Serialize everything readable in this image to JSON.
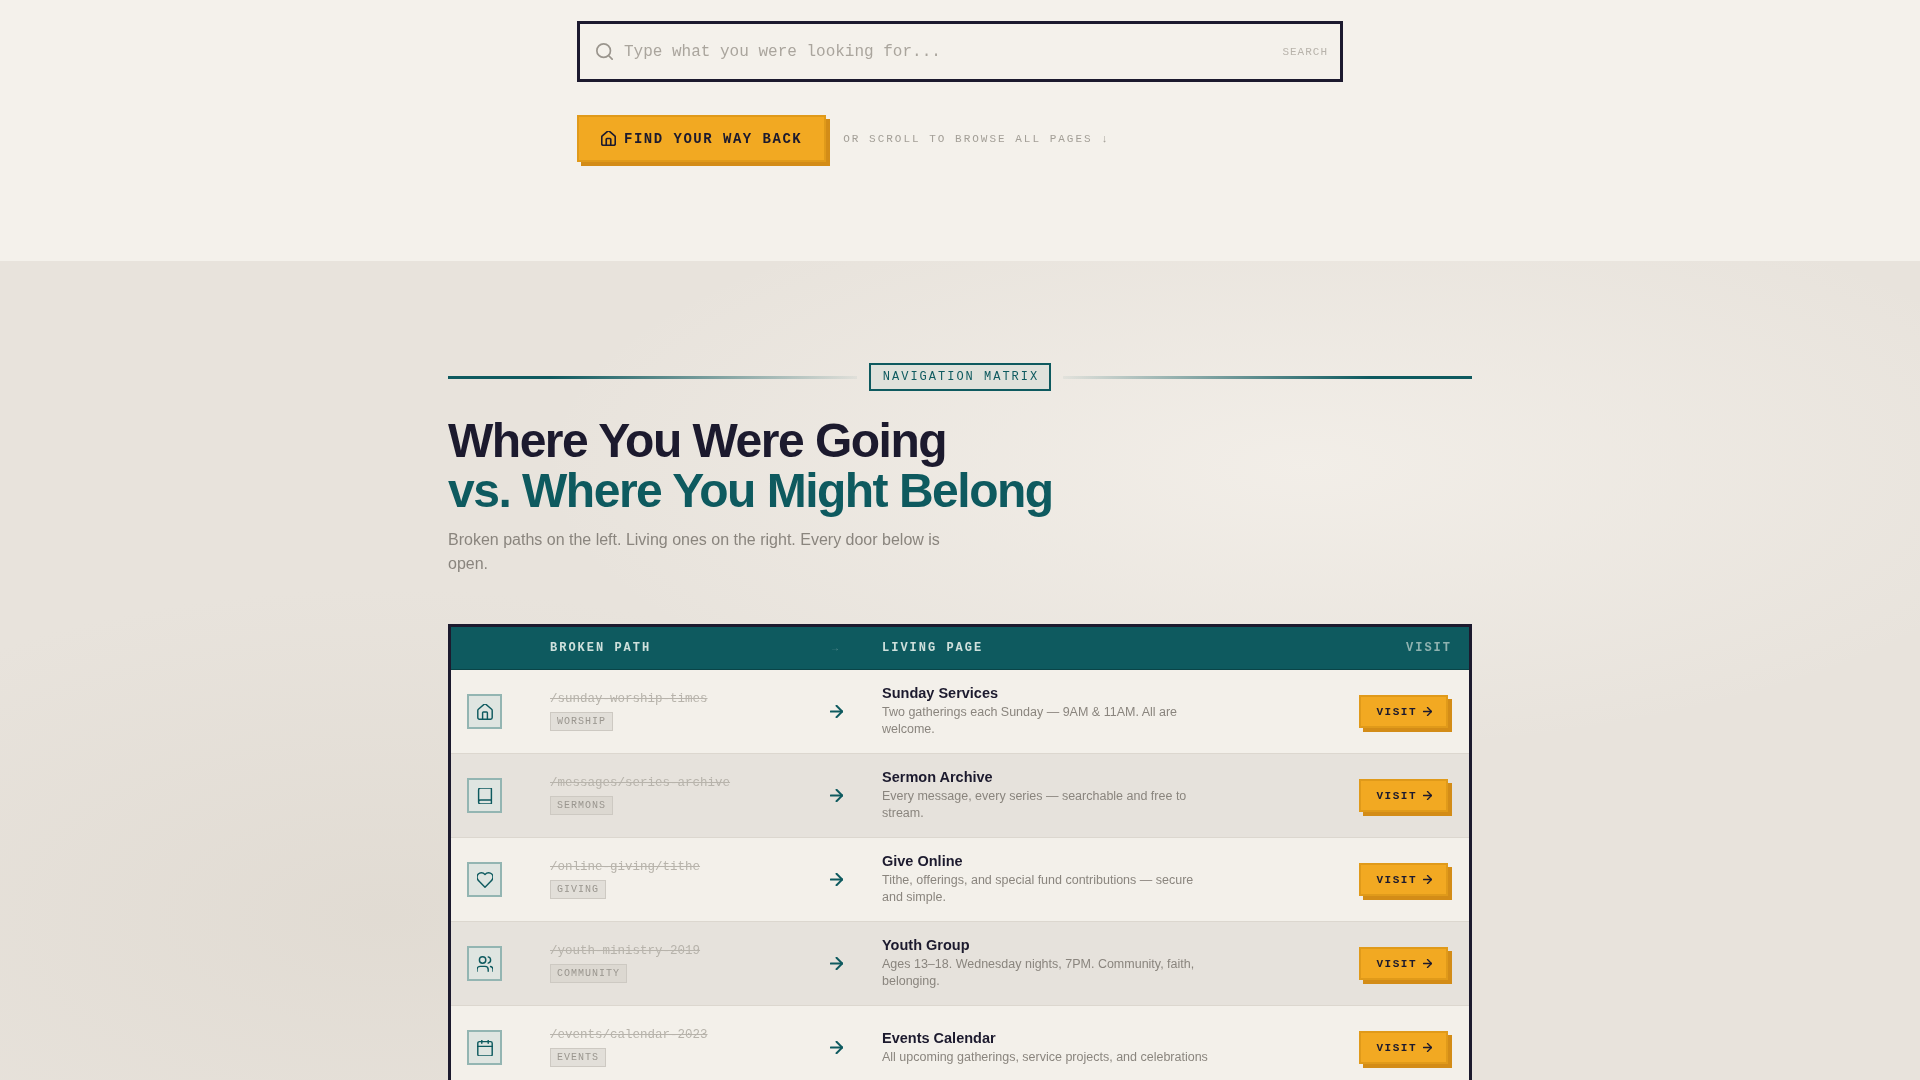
{
  "search": {
    "placeholder": "Type what you were looking for...",
    "button": "SEARCH"
  },
  "home_button": {
    "label": "FIND YOUR WAY BACK"
  },
  "scroll_hint": "OR SCROLL TO BROWSE ALL PAGES ↓",
  "section": {
    "label": "NAVIGATION MATRIX",
    "title": "Where You Were Going",
    "title_accent": "vs. Where You Might Belong",
    "intro": "Broken paths on the left. Living ones on the right. Every door below is open."
  },
  "table": {
    "columns": [
      "BROKEN PATH",
      "→",
      "LIVING PAGE",
      "VISIT"
    ],
    "rows": [
      {
        "broken_path": "/sunday-worship-times",
        "tag": "WORSHIP",
        "page": "Sunday Services",
        "description": "Two gatherings each Sunday — 9AM & 11AM. All are welcome.",
        "action": "VISIT"
      },
      {
        "broken_path": "/messages/series-archive",
        "tag": "SERMONS",
        "page": "Sermon Archive",
        "description": "Every message, every series — searchable and free to stream.",
        "action": "VISIT"
      },
      {
        "broken_path": "/online-giving/tithe",
        "tag": "GIVING",
        "page": "Give Online",
        "description": "Tithe, offerings, and special fund contributions — secure and simple.",
        "action": "VISIT"
      },
      {
        "broken_path": "/youth-ministry-2019",
        "tag": "COMMUNITY",
        "page": "Youth Group",
        "description": "Ages 13–18. Wednesday nights, 7PM. Community, faith, belonging.",
        "action": "VISIT"
      },
      {
        "broken_path": "/events/calendar-2023",
        "tag": "EVENTS",
        "page": "Events Calendar",
        "description": "All upcoming gatherings, service projects, and celebrations",
        "action": "VISIT"
      }
    ]
  }
}
